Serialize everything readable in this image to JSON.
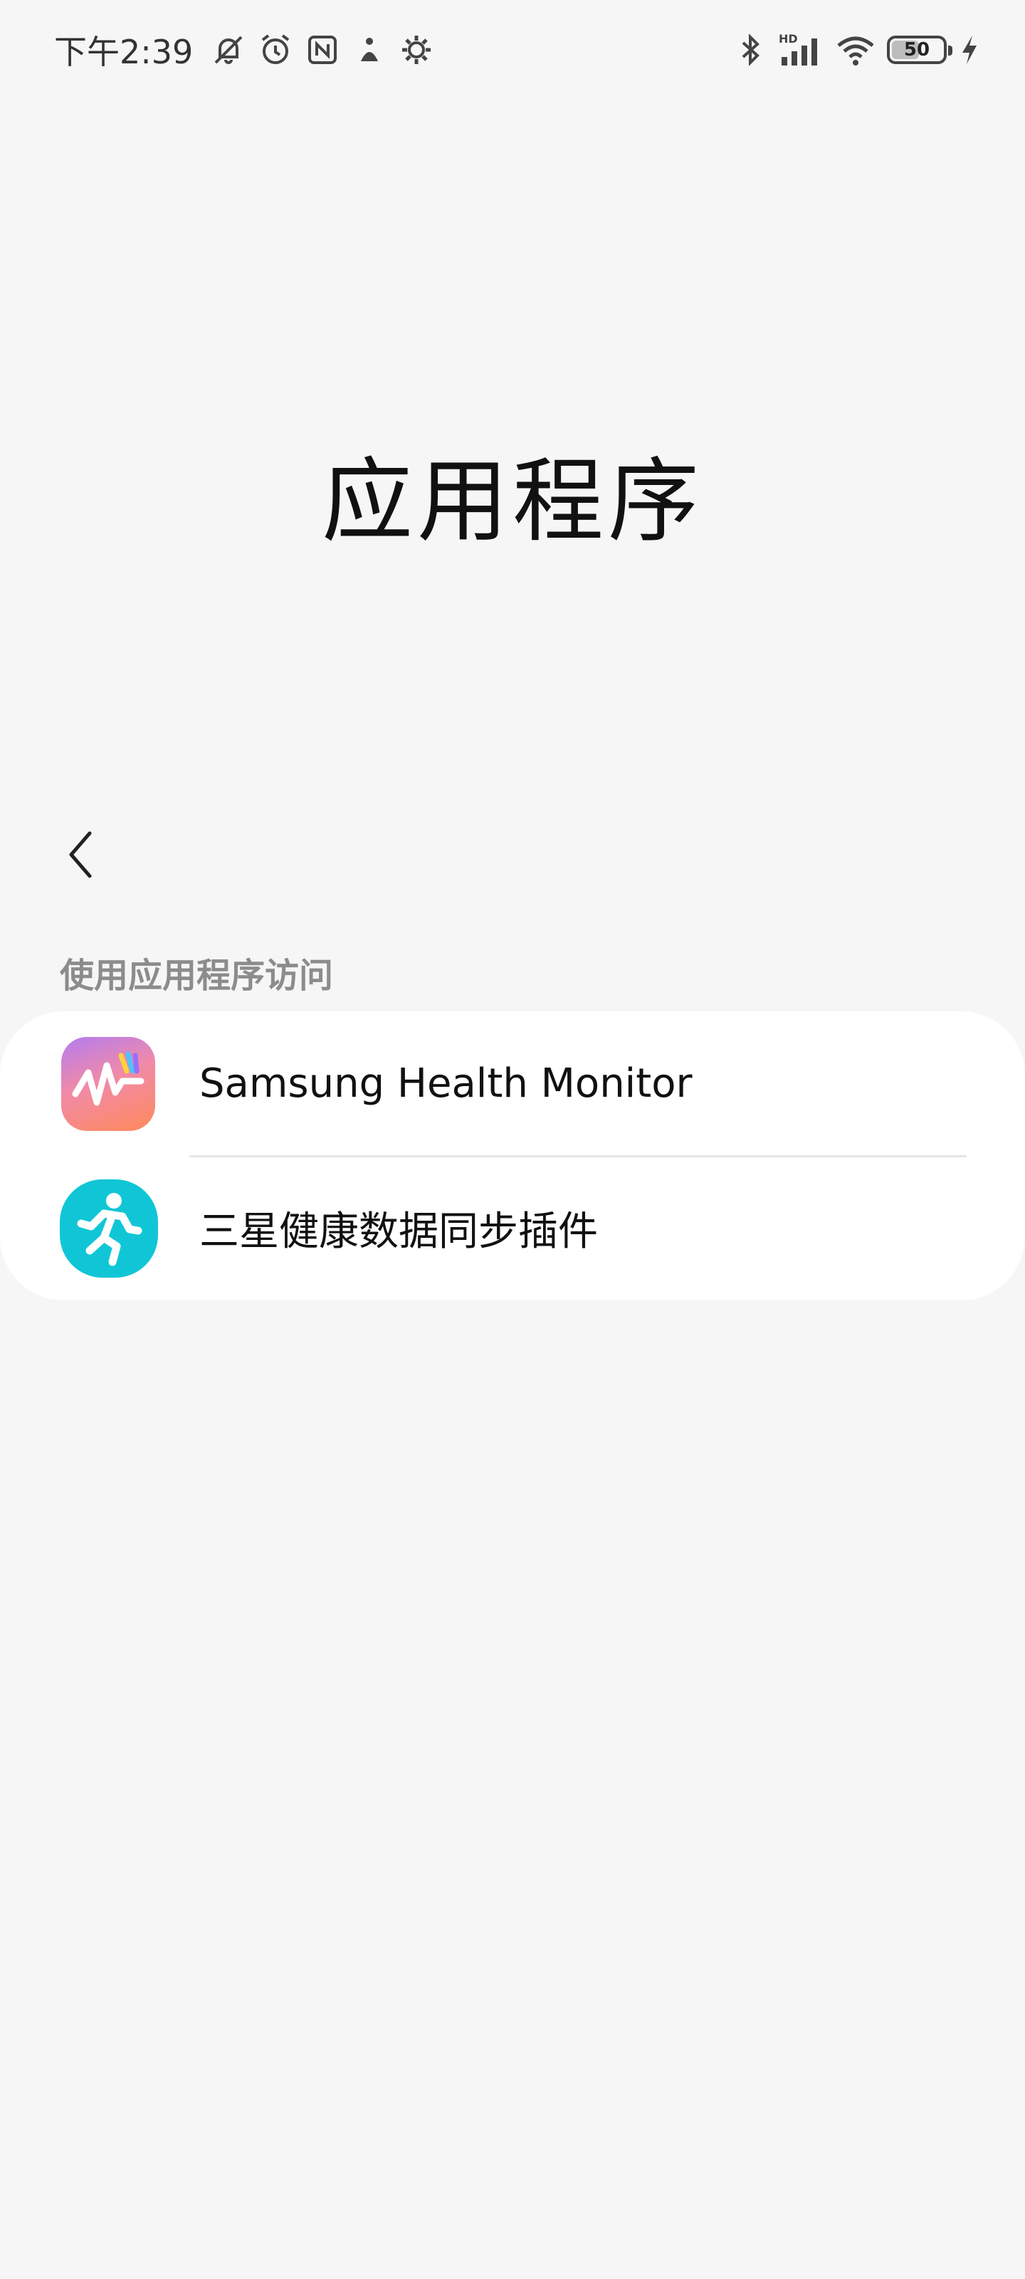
{
  "status_bar": {
    "time": "下午2:39",
    "battery_level": "50",
    "network_label": "HD",
    "icons_left": [
      "bell-muted-icon",
      "alarm-icon",
      "nfc-icon",
      "app-notification-icon",
      "settings-gear-icon"
    ],
    "icons_right": [
      "bluetooth-icon",
      "signal-icon",
      "wifi-icon",
      "battery-icon",
      "charging-icon"
    ]
  },
  "header": {
    "title": "应用程序"
  },
  "section": {
    "title": "使用应用程序访问"
  },
  "apps": [
    {
      "name": "Samsung Health Monitor",
      "icon": "samsung-health-monitor-icon"
    },
    {
      "name": "三星健康数据同步插件",
      "icon": "samsung-health-sync-icon"
    }
  ],
  "colors": {
    "background": "#f6f6f6",
    "card": "#ffffff",
    "section_text": "#8c8c8c",
    "health_icon": "#10c6d6"
  }
}
